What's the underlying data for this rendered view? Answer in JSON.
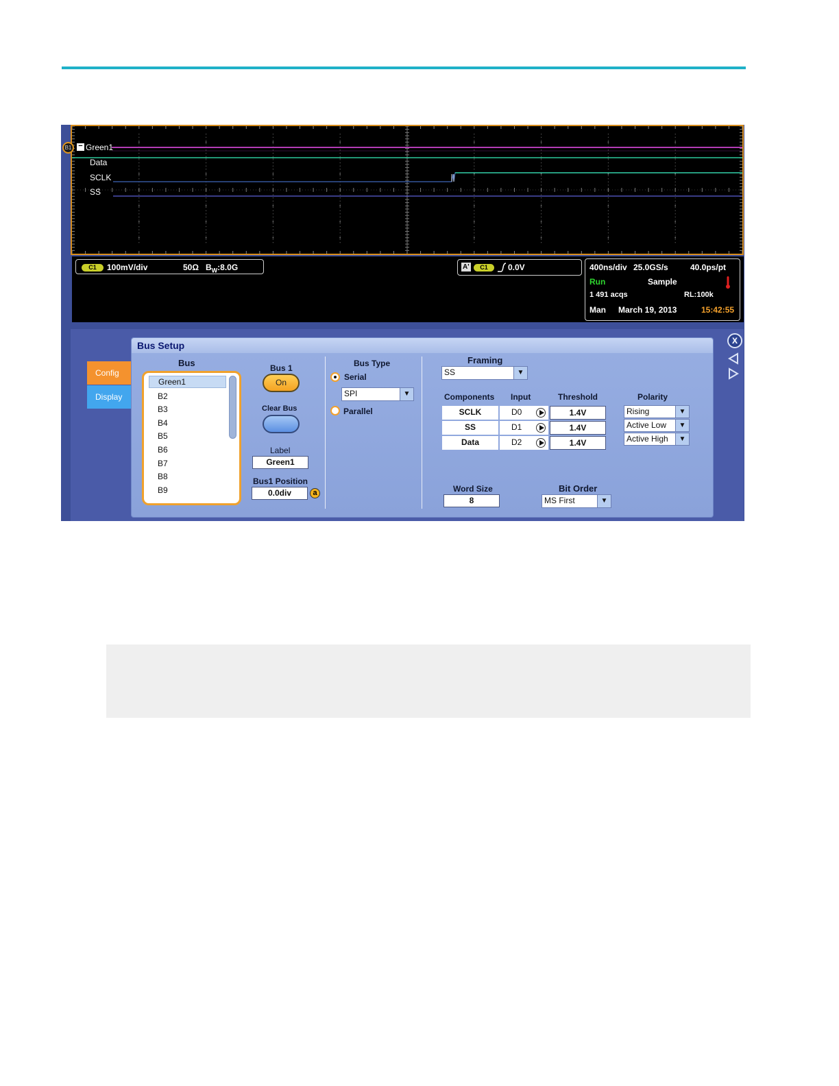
{
  "colors": {
    "accent_rule": "#1fb1c8",
    "bus_trace": "#b23bb4",
    "data_trace": "#2ec79a",
    "sclk_trace": "#3f67b8",
    "ss_trace": "#5b5fd6",
    "run": "#2fd62f",
    "time": "#f4a12c"
  },
  "waveform": {
    "bus_badge": "B1",
    "bus_name": "Green1",
    "signals": [
      "Data",
      "SCLK",
      "SS"
    ]
  },
  "readout": {
    "channel_tag": "C1",
    "vertical_scale": "100mV/div",
    "termination": "50Ω",
    "bandwidth_prefix": "B",
    "bandwidth_sub": "W",
    "bandwidth_value": ":8.0G",
    "trigger_tag": "A'",
    "trigger_channel": "C1",
    "trigger_level": "0.0V",
    "horizontal_scale": "400ns/div",
    "sample_rate": "25.0GS/s",
    "resolution": "40.0ps/pt",
    "run_state": "Run",
    "acq_mode": "Sample",
    "acqs": "1 491 acqs",
    "record_length": "RL:100k",
    "mode": "Man",
    "date": "March 19, 2013",
    "time": "15:42:55"
  },
  "dialog": {
    "title": "Bus Setup",
    "close_label": "X",
    "tabs": [
      {
        "label": "Config",
        "active": true
      },
      {
        "label": "Display",
        "active": false
      }
    ],
    "bus": {
      "header": "Bus",
      "items": [
        "Green1",
        "B2",
        "B3",
        "B4",
        "B5",
        "B6",
        "B7",
        "B8",
        "B9"
      ],
      "selected": "Green1"
    },
    "bus1": {
      "header": "Bus 1",
      "on_label": "On",
      "clear_label": "Clear Bus",
      "label_header": "Label",
      "label_value": "Green1",
      "position_header": "Bus1 Position",
      "position_value": "0.0div",
      "knob_label": "a"
    },
    "bus_type": {
      "header": "Bus Type",
      "serial_label": "Serial",
      "parallel_label": "Parallel",
      "selected": "Serial",
      "protocol": "SPI"
    },
    "framing": {
      "header": "Framing",
      "value": "SS"
    },
    "components": {
      "headers": [
        "Components",
        "Input",
        "Threshold",
        "Polarity"
      ],
      "rows": [
        {
          "name": "SCLK",
          "input": "D0",
          "threshold": "1.4V",
          "polarity": "Rising"
        },
        {
          "name": "SS",
          "input": "D1",
          "threshold": "1.4V",
          "polarity": "Active Low"
        },
        {
          "name": "Data",
          "input": "D2",
          "threshold": "1.4V",
          "polarity": "Active High"
        }
      ]
    },
    "word_size": {
      "header": "Word Size",
      "value": "8"
    },
    "bit_order": {
      "header": "Bit Order",
      "value": "MS First"
    },
    "dropdown_arrow": "▼"
  }
}
